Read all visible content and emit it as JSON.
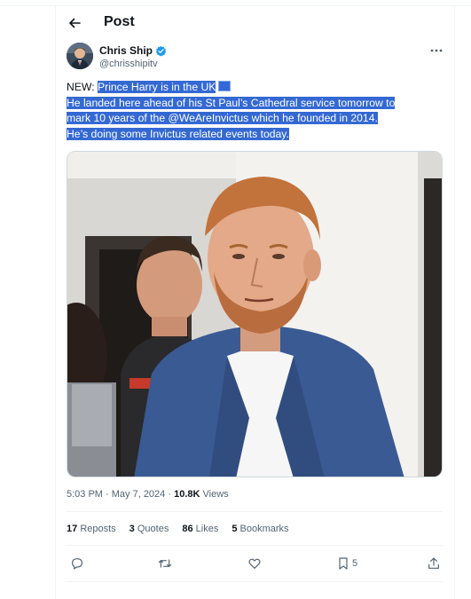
{
  "header": {
    "title": "Post"
  },
  "author": {
    "name": "Chris Ship",
    "handle": "@chrisshipitv"
  },
  "tweet": {
    "prefix": "NEW: ",
    "line1": "Prince Harry is in the UK",
    "line2": "He landed here ahead of his St Paul’s Cathedral service tomorrow to",
    "line3": "mark 10 years of the @WeAreInvictus which he founded in 2014.",
    "line4": "He’s doing some Invictus related events today."
  },
  "meta": {
    "time": "5:03 PM",
    "date": "May 7, 2024",
    "views_count": "10.8K",
    "views_label": "Views"
  },
  "stats": {
    "reposts_count": "17",
    "reposts_label": "Reposts",
    "quotes_count": "3",
    "quotes_label": "Quotes",
    "likes_count": "86",
    "likes_label": "Likes",
    "bookmarks_count": "5",
    "bookmarks_label": "Bookmarks"
  },
  "actions": {
    "bookmark_count": "5"
  },
  "icons": [
    "back-arrow-icon",
    "verified-badge-icon",
    "more-icon",
    "reply-icon",
    "repost-icon",
    "like-icon",
    "bookmark-icon",
    "share-icon"
  ],
  "colors": {
    "verified": "#1d9bf0",
    "selection": "#3469d4",
    "muted_text": "#536471"
  }
}
